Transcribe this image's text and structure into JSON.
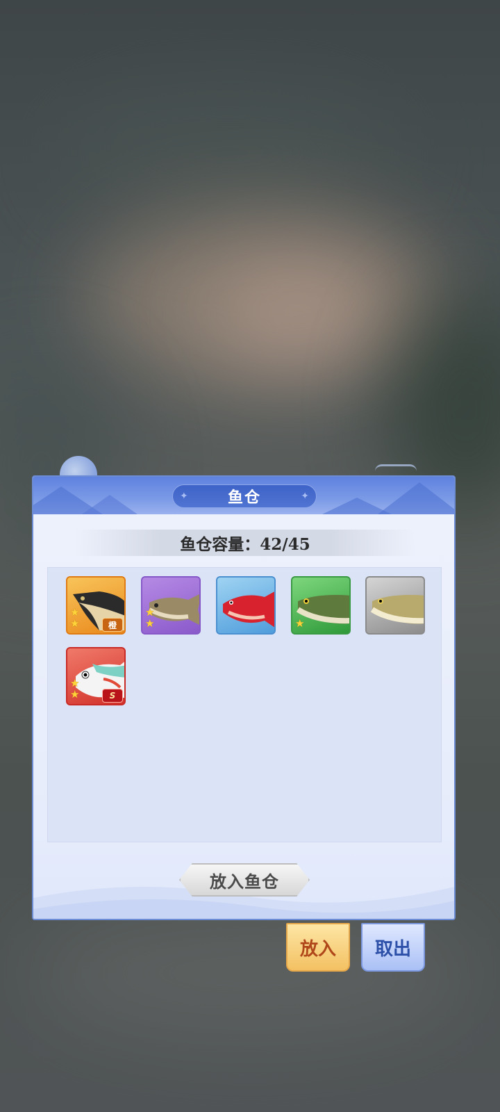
{
  "dialog": {
    "title": "鱼仓",
    "capacity_text": "鱼仓容量：42/45",
    "deposit_label": "放入鱼仓"
  },
  "fish_items": [
    {
      "name": "black-fish",
      "rarity_color": "orange",
      "stars": 2,
      "badge": "橙",
      "badge_color": "#c76512"
    },
    {
      "name": "carp",
      "rarity_color": "purple",
      "stars": 2,
      "badge": ""
    },
    {
      "name": "red-snapper",
      "rarity_color": "blue",
      "stars": 0,
      "badge": ""
    },
    {
      "name": "arowana-green",
      "rarity_color": "green",
      "stars": 1,
      "badge": ""
    },
    {
      "name": "arowana-gray",
      "rarity_color": "gray",
      "stars": 0,
      "badge": ""
    },
    {
      "name": "koi",
      "rarity_color": "red",
      "stars": 2,
      "badge": "S",
      "badge_color": "#b8141a"
    }
  ],
  "actions": {
    "put_label": "放入",
    "take_label": "取出"
  },
  "colors": {
    "header_blue": "#5f82df",
    "orange": "#e9891c",
    "purple": "#8a5acb",
    "blue": "#4f9ddc",
    "green": "#2f9a3a",
    "gray": "#8d8d8d",
    "red": "#d2322a"
  }
}
